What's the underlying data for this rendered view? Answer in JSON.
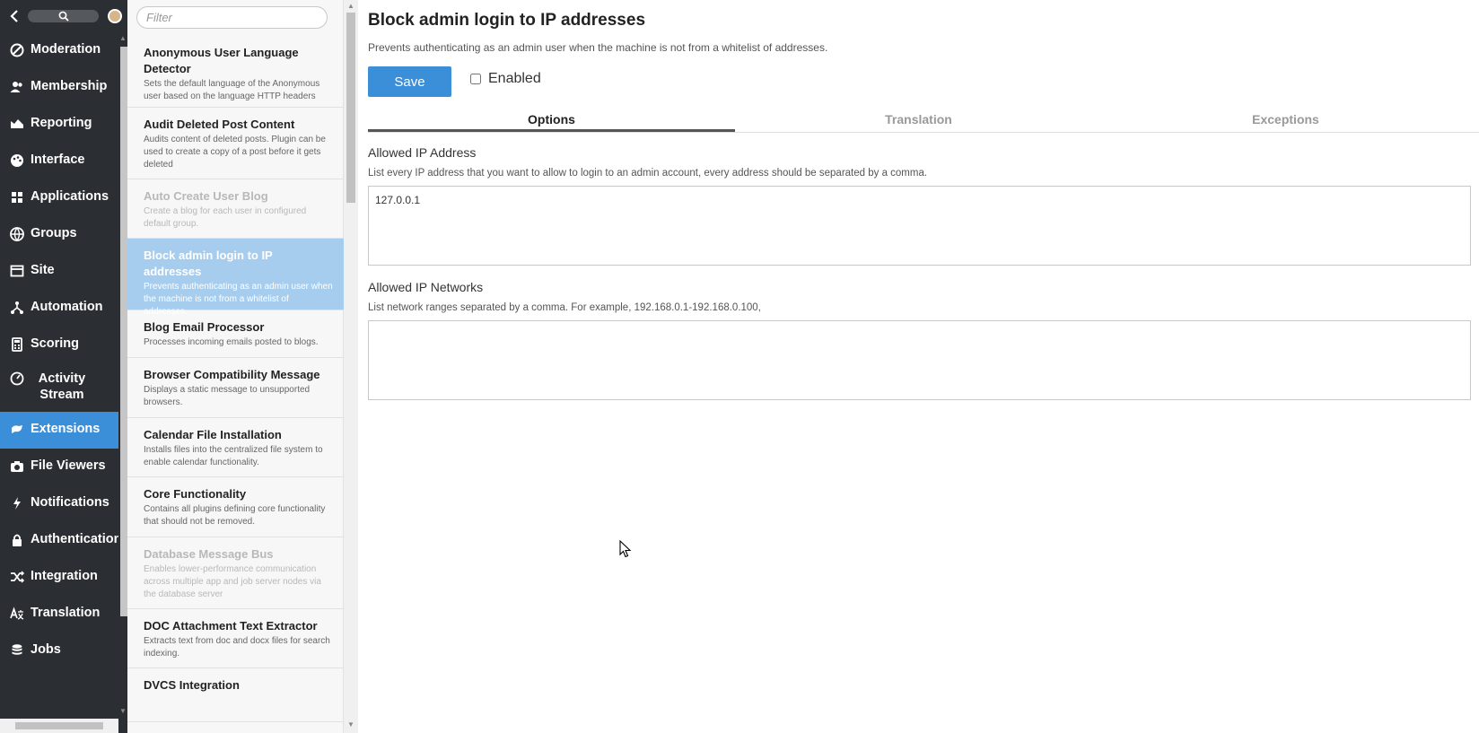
{
  "nav": {
    "items": [
      {
        "label": "Moderation",
        "icon": "ban-icon"
      },
      {
        "label": "Membership",
        "icon": "users-icon"
      },
      {
        "label": "Reporting",
        "icon": "area-chart-icon"
      },
      {
        "label": "Interface",
        "icon": "palette-icon"
      },
      {
        "label": "Applications",
        "icon": "grid-icon"
      },
      {
        "label": "Groups",
        "icon": "globe-icon"
      },
      {
        "label": "Site",
        "icon": "window-icon"
      },
      {
        "label": "Automation",
        "icon": "sitemap-icon"
      },
      {
        "label": "Scoring",
        "icon": "calculator-icon"
      },
      {
        "label": "Activity Stream",
        "icon": "dashboard-icon"
      },
      {
        "label": "Extensions",
        "icon": "puzzle-icon",
        "active": true
      },
      {
        "label": "File Viewers",
        "icon": "camera-icon"
      },
      {
        "label": "Notifications",
        "icon": "bolt-icon"
      },
      {
        "label": "Authentication",
        "icon": "lock-icon"
      },
      {
        "label": "Integration",
        "icon": "shuffle-icon"
      },
      {
        "label": "Translation",
        "icon": "translate-icon"
      },
      {
        "label": "Jobs",
        "icon": "database-icon"
      }
    ]
  },
  "filter": {
    "placeholder": "Filter"
  },
  "plugins": [
    {
      "title": "Anonymous User Language Detector",
      "desc": "Sets the default language of the Anonymous user based on the language HTTP headers"
    },
    {
      "title": "Audit Deleted Post Content",
      "desc": "Audits content of deleted posts. Plugin can be used to create a copy of a post before it gets deleted"
    },
    {
      "title": "Auto Create User Blog",
      "desc": "Create a blog for each user in configured default group.",
      "disabled": true
    },
    {
      "title": "Block admin login to IP addresses",
      "desc": "Prevents authenticating as an admin user when the machine is not from a whitelist of addresses.",
      "selected": true
    },
    {
      "title": "Blog Email Processor",
      "desc": "Processes incoming emails posted to blogs."
    },
    {
      "title": "Browser Compatibility Message",
      "desc": "Displays a static message to unsupported browsers."
    },
    {
      "title": "Calendar File Installation",
      "desc": "Installs files into the centralized file system to enable calendar functionality."
    },
    {
      "title": "Core Functionality",
      "desc": "Contains all plugins defining core functionality that should not be removed."
    },
    {
      "title": "Database Message Bus",
      "desc": "Enables lower-performance communication across multiple app and job server nodes via the database server",
      "disabled": true
    },
    {
      "title": "DOC Attachment Text Extractor",
      "desc": "Extracts text from doc and docx files for search indexing."
    },
    {
      "title": "DVCS Integration",
      "desc": ""
    }
  ],
  "main": {
    "title": "Block admin login to IP addresses",
    "description": "Prevents authenticating as an admin user when the machine is not from a whitelist of addresses.",
    "save_label": "Save",
    "enabled_label": "Enabled",
    "enabled": false,
    "tabs": [
      "Options",
      "Translation",
      "Exceptions"
    ],
    "active_tab": "Options",
    "ip_address": {
      "label": "Allowed IP Address",
      "help": "List every IP address that you want to allow to login to an admin account, every address should be separated by a comma.",
      "value": "127.0.0.1"
    },
    "ip_networks": {
      "label": "Allowed IP Networks",
      "help": "List network ranges separated by a comma. For example, 192.168.0.1-192.168.0.100,",
      "value": ""
    }
  },
  "colors": {
    "accent": "#3b8fd9",
    "nav_bg": "#2b2f33",
    "selected_item": "#a7cdee"
  }
}
